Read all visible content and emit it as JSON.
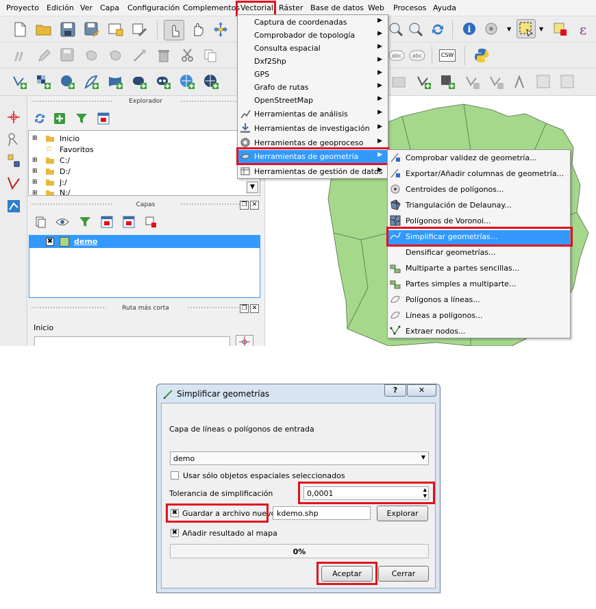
{
  "menubar": {
    "items": [
      "Proyecto",
      "Edición",
      "Ver",
      "Capa",
      "Configuración",
      "Complementos",
      "Vectorial",
      "Ráster",
      "Base de datos",
      "Web",
      "Procesos",
      "Ayuda"
    ]
  },
  "vector_menu": {
    "items": [
      {
        "label": "Captura de coordenadas",
        "submenu": true
      },
      {
        "label": "Comprobador de topología",
        "submenu": true
      },
      {
        "label": "Consulta espacial",
        "submenu": true
      },
      {
        "label": "Dxf2Shp",
        "submenu": true
      },
      {
        "label": "GPS",
        "submenu": true
      },
      {
        "label": "Grafo de rutas",
        "submenu": true
      },
      {
        "label": "OpenStreetMap",
        "submenu": true
      },
      {
        "label": "Herramientas de análisis",
        "submenu": true
      },
      {
        "label": "Herramientas de investigación",
        "submenu": true
      },
      {
        "label": "Herramientas de geoproceso",
        "submenu": true
      },
      {
        "label": "Herramientas de geometría",
        "submenu": true
      },
      {
        "label": "Herramientas de gestión de datos",
        "submenu": true
      }
    ]
  },
  "geometry_menu": {
    "items": [
      "Comprobar validez de geometría...",
      "Exportar/Añadir columnas de geometría...",
      "Centroides de polígonos...",
      "Triangulación de Delaunay...",
      "Polígonos de Voronoi...",
      "Simplificar geometrías...",
      "Densificar geometrías...",
      "Multiparte a partes sencillas...",
      "Partes simples a multiparte...",
      "Polígonos a líneas...",
      "Líneas a polígonos...",
      "Extraer nodos..."
    ]
  },
  "toolbar": {
    "csw_label": "CSW",
    "abc_label": "abc",
    "epsilon_glyph": "ε"
  },
  "browser_panel": {
    "title": "Explorador",
    "tree": [
      "Inicio",
      "Favoritos",
      "C:/",
      "D:/",
      "J:/",
      "N:/"
    ]
  },
  "layers_panel": {
    "title": "Capas",
    "layer_name": "demo"
  },
  "route_panel": {
    "title": "Ruta más corta",
    "start_label": "Inicio"
  },
  "dialog": {
    "title": "Simplificar geometrías",
    "help_glyph": "?",
    "input_label": "Capa de líneas o polígonos de entrada",
    "input_value": "demo",
    "selected_only_label": "Usar sólo objetos espaciales seleccionados",
    "tolerance_label": "Tolerancia de simplificación",
    "tolerance_value": "0,0001",
    "save_label": "Guardar a archivo nuevo",
    "save_path": "kdemo.shp",
    "browse_label": "Explorar",
    "add_result_label": "Añadir resultado al mapa",
    "progress_text": "0%",
    "progress": 0,
    "accept_label": "Aceptar",
    "close_label": "Cerrar"
  },
  "colors": {
    "highlight": "#e2101e",
    "menu_selection": "#3399ff",
    "polygon_fill": "#a6d88c",
    "layer_selection": "#3399ff"
  }
}
